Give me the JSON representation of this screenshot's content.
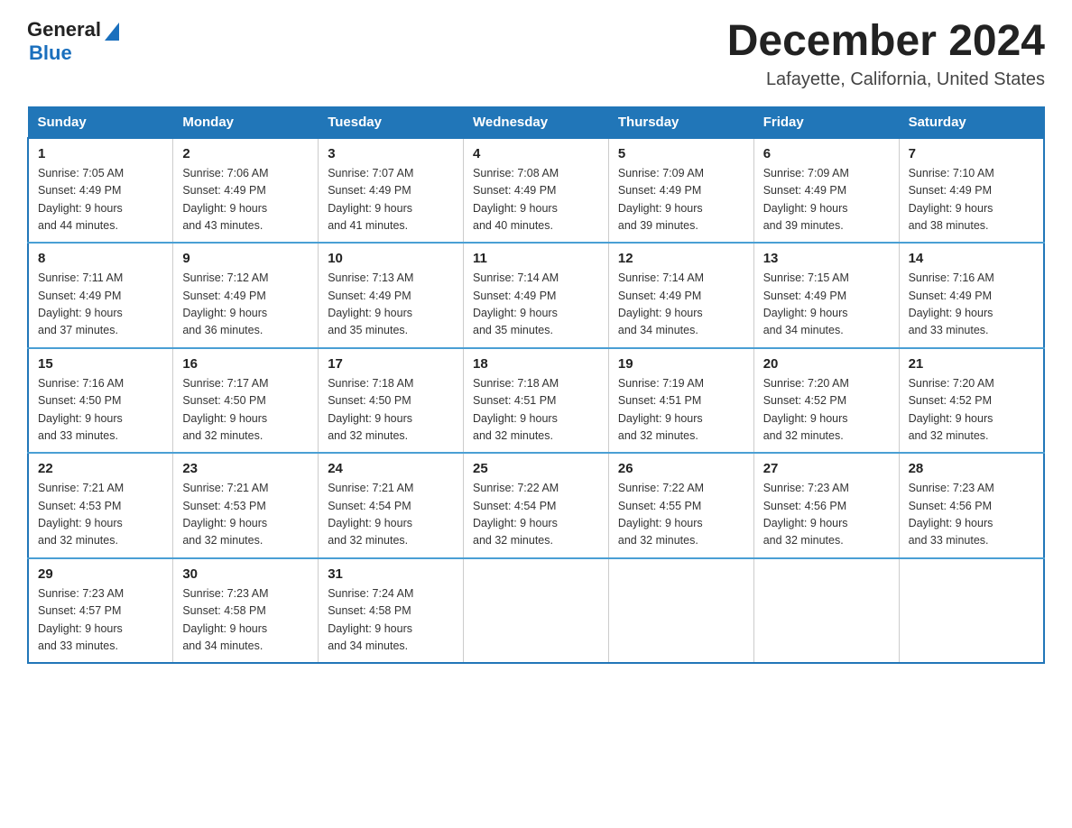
{
  "header": {
    "logo_general": "General",
    "logo_blue": "Blue",
    "title": "December 2024",
    "subtitle": "Lafayette, California, United States"
  },
  "days_of_week": [
    "Sunday",
    "Monday",
    "Tuesday",
    "Wednesday",
    "Thursday",
    "Friday",
    "Saturday"
  ],
  "weeks": [
    [
      {
        "day": "1",
        "sunrise": "7:05 AM",
        "sunset": "4:49 PM",
        "daylight": "9 hours and 44 minutes."
      },
      {
        "day": "2",
        "sunrise": "7:06 AM",
        "sunset": "4:49 PM",
        "daylight": "9 hours and 43 minutes."
      },
      {
        "day": "3",
        "sunrise": "7:07 AM",
        "sunset": "4:49 PM",
        "daylight": "9 hours and 41 minutes."
      },
      {
        "day": "4",
        "sunrise": "7:08 AM",
        "sunset": "4:49 PM",
        "daylight": "9 hours and 40 minutes."
      },
      {
        "day": "5",
        "sunrise": "7:09 AM",
        "sunset": "4:49 PM",
        "daylight": "9 hours and 39 minutes."
      },
      {
        "day": "6",
        "sunrise": "7:09 AM",
        "sunset": "4:49 PM",
        "daylight": "9 hours and 39 minutes."
      },
      {
        "day": "7",
        "sunrise": "7:10 AM",
        "sunset": "4:49 PM",
        "daylight": "9 hours and 38 minutes."
      }
    ],
    [
      {
        "day": "8",
        "sunrise": "7:11 AM",
        "sunset": "4:49 PM",
        "daylight": "9 hours and 37 minutes."
      },
      {
        "day": "9",
        "sunrise": "7:12 AM",
        "sunset": "4:49 PM",
        "daylight": "9 hours and 36 minutes."
      },
      {
        "day": "10",
        "sunrise": "7:13 AM",
        "sunset": "4:49 PM",
        "daylight": "9 hours and 35 minutes."
      },
      {
        "day": "11",
        "sunrise": "7:14 AM",
        "sunset": "4:49 PM",
        "daylight": "9 hours and 35 minutes."
      },
      {
        "day": "12",
        "sunrise": "7:14 AM",
        "sunset": "4:49 PM",
        "daylight": "9 hours and 34 minutes."
      },
      {
        "day": "13",
        "sunrise": "7:15 AM",
        "sunset": "4:49 PM",
        "daylight": "9 hours and 34 minutes."
      },
      {
        "day": "14",
        "sunrise": "7:16 AM",
        "sunset": "4:49 PM",
        "daylight": "9 hours and 33 minutes."
      }
    ],
    [
      {
        "day": "15",
        "sunrise": "7:16 AM",
        "sunset": "4:50 PM",
        "daylight": "9 hours and 33 minutes."
      },
      {
        "day": "16",
        "sunrise": "7:17 AM",
        "sunset": "4:50 PM",
        "daylight": "9 hours and 32 minutes."
      },
      {
        "day": "17",
        "sunrise": "7:18 AM",
        "sunset": "4:50 PM",
        "daylight": "9 hours and 32 minutes."
      },
      {
        "day": "18",
        "sunrise": "7:18 AM",
        "sunset": "4:51 PM",
        "daylight": "9 hours and 32 minutes."
      },
      {
        "day": "19",
        "sunrise": "7:19 AM",
        "sunset": "4:51 PM",
        "daylight": "9 hours and 32 minutes."
      },
      {
        "day": "20",
        "sunrise": "7:20 AM",
        "sunset": "4:52 PM",
        "daylight": "9 hours and 32 minutes."
      },
      {
        "day": "21",
        "sunrise": "7:20 AM",
        "sunset": "4:52 PM",
        "daylight": "9 hours and 32 minutes."
      }
    ],
    [
      {
        "day": "22",
        "sunrise": "7:21 AM",
        "sunset": "4:53 PM",
        "daylight": "9 hours and 32 minutes."
      },
      {
        "day": "23",
        "sunrise": "7:21 AM",
        "sunset": "4:53 PM",
        "daylight": "9 hours and 32 minutes."
      },
      {
        "day": "24",
        "sunrise": "7:21 AM",
        "sunset": "4:54 PM",
        "daylight": "9 hours and 32 minutes."
      },
      {
        "day": "25",
        "sunrise": "7:22 AM",
        "sunset": "4:54 PM",
        "daylight": "9 hours and 32 minutes."
      },
      {
        "day": "26",
        "sunrise": "7:22 AM",
        "sunset": "4:55 PM",
        "daylight": "9 hours and 32 minutes."
      },
      {
        "day": "27",
        "sunrise": "7:23 AM",
        "sunset": "4:56 PM",
        "daylight": "9 hours and 32 minutes."
      },
      {
        "day": "28",
        "sunrise": "7:23 AM",
        "sunset": "4:56 PM",
        "daylight": "9 hours and 33 minutes."
      }
    ],
    [
      {
        "day": "29",
        "sunrise": "7:23 AM",
        "sunset": "4:57 PM",
        "daylight": "9 hours and 33 minutes."
      },
      {
        "day": "30",
        "sunrise": "7:23 AM",
        "sunset": "4:58 PM",
        "daylight": "9 hours and 34 minutes."
      },
      {
        "day": "31",
        "sunrise": "7:24 AM",
        "sunset": "4:58 PM",
        "daylight": "9 hours and 34 minutes."
      },
      null,
      null,
      null,
      null
    ]
  ],
  "labels": {
    "sunrise": "Sunrise:",
    "sunset": "Sunset:",
    "daylight": "Daylight:"
  }
}
